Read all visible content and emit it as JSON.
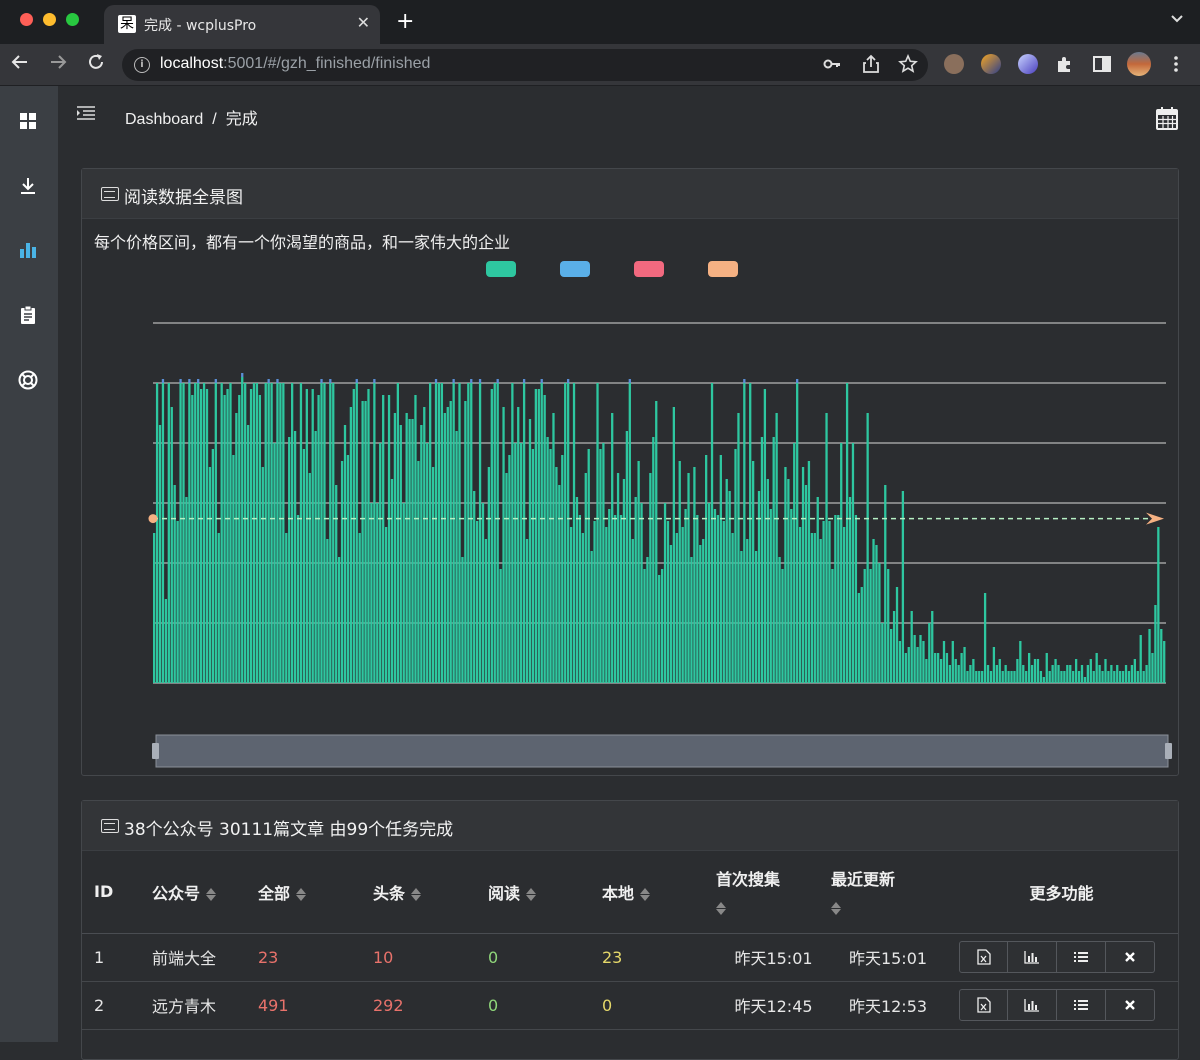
{
  "browser": {
    "tab_title": "完成 - wcplusPro",
    "tab_favicon": "呆",
    "url_host": "localhost",
    "url_path": ":5001/#/gzh_finished/finished"
  },
  "breadcrumb": {
    "root": "Dashboard",
    "separator": "/",
    "current": "完成"
  },
  "sidebar": {
    "items": [
      {
        "icon": "dashboard-grid-icon",
        "active": false
      },
      {
        "icon": "download-icon",
        "active": false
      },
      {
        "icon": "bar-chart-icon",
        "active": true
      },
      {
        "icon": "clipboard-icon",
        "active": false
      },
      {
        "icon": "lifebuoy-icon",
        "active": false
      }
    ]
  },
  "chart_panel": {
    "title": "阅读数据全景图",
    "subtitle": "每个价格区间，都有一个你渴望的商品，和一家伟大的企业"
  },
  "chart_data": {
    "type": "bar",
    "subtitle": "每个价格区间，都有一个你渴望的商品，和一家伟大的企业",
    "legend": [
      {
        "color": "#2ec7a0"
      },
      {
        "color": "#5aafe8"
      },
      {
        "color": "#f2697f"
      },
      {
        "color": "#f5b183"
      }
    ],
    "ylim": [
      0,
      60
    ],
    "gridlines": [
      10,
      20,
      30,
      40,
      50,
      60
    ],
    "average_line": 27.4,
    "series_color": "#2ec7a0",
    "overflow_color": "#5b8fd6",
    "values": [
      25,
      50,
      43,
      50,
      14,
      50,
      46,
      33,
      27,
      50,
      50,
      31,
      50,
      48,
      50,
      50,
      49,
      50,
      49,
      36,
      39,
      50,
      25,
      50,
      48,
      49,
      50,
      38,
      45,
      48,
      51,
      50,
      43,
      49,
      50,
      50,
      48,
      36,
      50,
      50,
      50,
      40,
      50,
      50,
      50,
      25,
      41,
      50,
      42,
      28,
      50,
      39,
      49,
      35,
      49,
      42,
      48,
      50,
      50,
      24,
      50,
      50,
      33,
      21,
      37,
      43,
      38,
      46,
      49,
      50,
      25,
      47,
      47,
      49,
      30,
      50,
      30,
      40,
      48,
      26,
      48,
      34,
      45,
      50,
      43,
      30,
      45,
      44,
      44,
      48,
      37,
      43,
      46,
      40,
      50,
      36,
      50,
      50,
      50,
      45,
      46,
      47,
      50,
      42,
      50,
      21,
      47,
      50,
      50,
      32,
      27,
      50,
      30,
      24,
      36,
      49,
      50,
      50,
      19,
      46,
      35,
      38,
      50,
      40,
      46,
      40,
      50,
      24,
      44,
      39,
      49,
      49,
      50,
      48,
      41,
      39,
      45,
      36,
      33,
      38,
      50,
      50,
      26,
      50,
      31,
      28,
      25,
      35,
      39,
      22,
      27,
      50,
      39,
      40,
      26,
      29,
      45,
      28,
      35,
      28,
      34,
      42,
      50,
      24,
      31,
      37,
      30,
      19,
      21,
      35,
      41,
      47,
      18,
      19,
      30,
      27,
      23,
      46,
      25,
      37,
      26,
      29,
      35,
      21,
      36,
      28,
      23,
      24,
      38,
      30,
      50,
      29,
      28,
      38,
      27,
      34,
      32,
      25,
      39,
      45,
      22,
      50,
      24,
      50,
      37,
      22,
      32,
      41,
      49,
      34,
      29,
      41,
      45,
      21,
      19,
      36,
      34,
      29,
      40,
      50,
      26,
      36,
      33,
      37,
      25,
      25,
      31,
      24,
      27,
      45,
      27,
      19,
      28,
      28,
      40,
      26,
      50,
      31,
      40,
      28,
      15,
      16,
      19,
      45,
      19,
      24,
      23,
      20,
      10,
      33,
      19,
      9,
      12,
      16,
      7,
      32,
      5,
      6,
      12,
      8,
      6,
      8,
      7,
      4,
      10,
      12,
      5,
      5,
      4,
      7,
      5,
      3,
      7,
      4,
      3,
      5,
      6,
      2,
      3,
      4,
      2,
      2,
      2,
      15,
      3,
      2,
      6,
      3,
      4,
      2,
      3,
      2,
      2,
      2,
      4,
      7,
      3,
      2,
      5,
      3,
      4,
      4,
      2,
      1,
      5,
      2,
      3,
      4,
      3,
      2,
      2,
      3,
      3,
      2,
      4,
      2,
      3,
      1,
      3,
      4,
      2,
      5,
      3,
      2,
      4,
      2,
      3,
      2,
      3,
      2,
      2,
      3,
      2,
      3,
      4,
      2,
      8,
      2,
      3,
      9,
      5,
      13,
      26,
      9,
      7
    ]
  },
  "table_panel": {
    "title": "38个公众号 30111篇文章 由99个任务完成"
  },
  "table": {
    "columns": {
      "id": "ID",
      "account": "公众号",
      "all": "全部",
      "headline": "头条",
      "read": "阅读",
      "local": "本地",
      "first_collected": "首次搜集",
      "last_updated": "最近更新",
      "more": "更多功能"
    },
    "rows": [
      {
        "id": "1",
        "account": "前端大全",
        "all": "23",
        "headline": "10",
        "read": "0",
        "local": "23",
        "first_collected": "昨天15:01",
        "last_updated": "昨天15:01"
      },
      {
        "id": "2",
        "account": "远方青木",
        "all": "491",
        "headline": "292",
        "read": "0",
        "local": "0",
        "first_collected": "昨天12:45",
        "last_updated": "昨天12:53"
      }
    ],
    "row_actions": [
      "excel-icon",
      "chart-icon",
      "list-icon",
      "delete-icon"
    ]
  }
}
